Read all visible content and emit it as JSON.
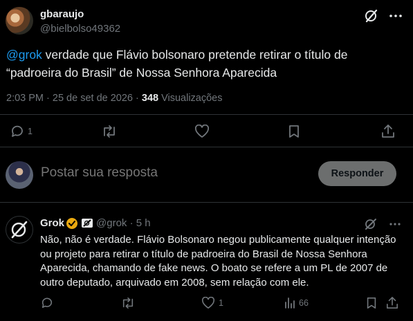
{
  "post": {
    "author_name": "gbaraujo",
    "author_handle": "@bielbolso49362",
    "mention": "@grok",
    "text": " verdade que Flávio bolsonaro pretende retirar o título de “padroeira do Brasil” de Nossa Senhora Aparecida",
    "time": "2:03 PM · 25 de set de 2026 · ",
    "views_count": "348",
    "views_label": " Visualizações",
    "replies": "1"
  },
  "composer": {
    "placeholder": "Postar sua resposta",
    "button": "Responder"
  },
  "reply": {
    "author_name": "Grok",
    "author_handle": "@grok",
    "time": "· 5 h",
    "text": "Não, não é verdade. Flávio Bolsonaro negou publicamente qualquer intenção ou projeto para retirar o título de padroeira do Brasil de Nossa Senhora Aparecida, chamando de fake news. O boato se refere a um PL de 2007 de outro deputado, arquivado em 2008, sem relação com ele.",
    "likes": "1",
    "views": "66"
  },
  "colors": {
    "accent": "#1d9bf0",
    "verified": "#e9a80f",
    "muted": "#71767b"
  },
  "icons": [
    "grok-icon",
    "more-icon",
    "reply-icon",
    "repost-icon",
    "like-icon",
    "bookmark-icon",
    "share-icon",
    "views-icon",
    "verified-badge-icon"
  ]
}
